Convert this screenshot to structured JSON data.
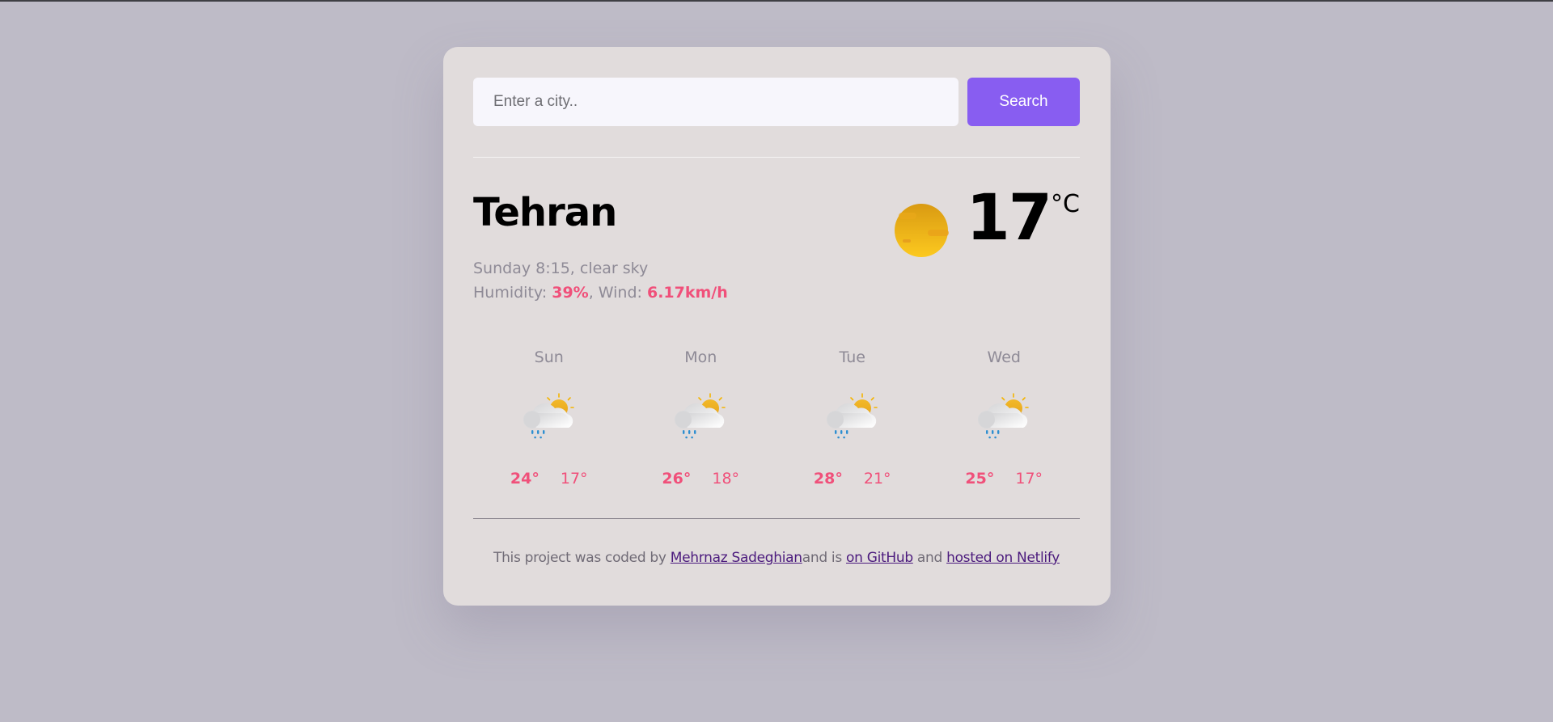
{
  "search": {
    "placeholder": "Enter a city..",
    "value": "",
    "button_label": "Search"
  },
  "current": {
    "city": "Tehran",
    "datetime_description": "Sunday 8:15, clear sky",
    "humidity_label": "Humidity: ",
    "humidity_value": "39%",
    "wind_label": ", Wind: ",
    "wind_value": "6.17km/h",
    "icon": "clear-sky-sun-icon",
    "temperature": "17",
    "unit": "°C"
  },
  "forecast": [
    {
      "day": "Sun",
      "icon": "partly-cloudy-rain-icon",
      "max": "24°",
      "min": "17°"
    },
    {
      "day": "Mon",
      "icon": "partly-cloudy-rain-icon",
      "max": "26°",
      "min": "18°"
    },
    {
      "day": "Tue",
      "icon": "partly-cloudy-rain-icon",
      "max": "28°",
      "min": "21°"
    },
    {
      "day": "Wed",
      "icon": "partly-cloudy-rain-icon",
      "max": "25°",
      "min": "17°"
    }
  ],
  "footer": {
    "text_before": "This project was coded by ",
    "author_link": "Mehrnaz Sadeghian",
    "text_middle": "and is ",
    "github_link": "on GitHub",
    "text_and": " and ",
    "netlify_link": "hosted on Netlify"
  },
  "colors": {
    "accent": "#885df1",
    "highlight": "#f0507a",
    "background": "#bebbc7",
    "card": "#e1dcdc",
    "link": "#4b1a7d"
  }
}
